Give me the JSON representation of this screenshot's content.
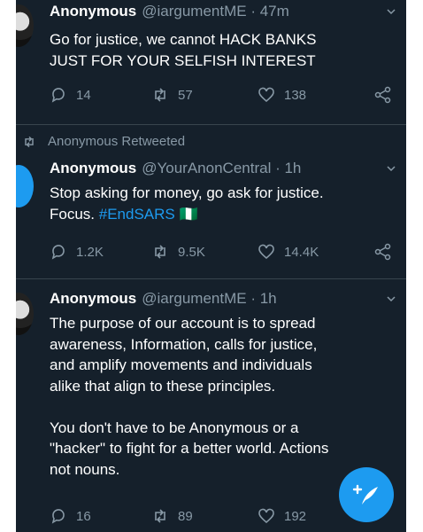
{
  "tweets": [
    {
      "name": "Anonymous",
      "handle": "@iargumentME",
      "time": "47m",
      "lines": [
        "Go for justice, we cannot HACK BANKS",
        "JUST FOR YOUR SELFISH INTEREST"
      ],
      "replies": "14",
      "retweets": "57",
      "likes": "138"
    },
    {
      "retweeted_by": "Anonymous Retweeted",
      "name": "Anonymous",
      "handle": "@YourAnonCentral",
      "time": "1h",
      "line1": "Stop asking for money, go ask for justice.",
      "line2_text": "Focus.",
      "hashtag": "#EndSARS",
      "flag_emoji": "🇳🇬",
      "replies": "1.2K",
      "retweets": "9.5K",
      "likes": "14.4K"
    },
    {
      "name": "Anonymous",
      "handle": "@iargumentME",
      "time": "1h",
      "lines": [
        "The purpose of our account is to spread",
        "awareness, Information, calls for justice,",
        "and amplify movements and individuals",
        "alike that align to these principles.",
        "",
        "You don't have to be Anonymous or a",
        "\"hacker\" to fight for a better world. Actions",
        "not nouns."
      ],
      "replies": "16",
      "retweets": "89",
      "likes": "192"
    }
  ],
  "separator": " · ",
  "icons": {
    "reply": "reply-icon",
    "retweet": "retweet-icon",
    "like": "heart-icon",
    "share": "share-icon",
    "chevron": "chevron-down-icon",
    "compose": "compose-tweet-icon"
  },
  "colors": {
    "background": "#15202b",
    "text": "#ffffff",
    "muted": "#8899a6",
    "accent": "#1d9bf0",
    "divider": "#38444d"
  }
}
